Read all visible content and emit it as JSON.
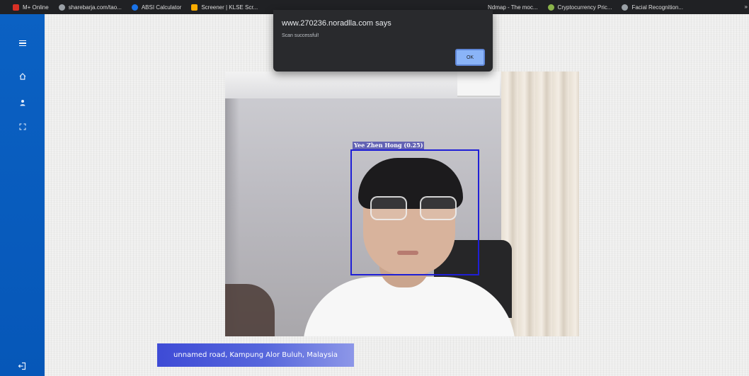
{
  "bookmarks_bar": {
    "left_items": [
      {
        "label": "M+ Online",
        "icon": "m-plus-icon",
        "color": "#d93025"
      },
      {
        "label": "sharebarja.com/tao...",
        "icon": "globe-icon",
        "color": "#9aa0a6"
      },
      {
        "label": "ABSI Calculator",
        "icon": "calculator-icon",
        "color": "#1a73e8"
      },
      {
        "label": "Screener | KLSE Scr...",
        "icon": "screener-icon",
        "color": "#f9ab00"
      }
    ],
    "right_items": [
      {
        "label": "Ndmap - The moc...",
        "icon": "bookmark-icon",
        "color": "#9aa0a6"
      },
      {
        "label": "Cryptocurrency Pric...",
        "icon": "crypto-icon",
        "color": "#8ab34a"
      },
      {
        "label": "Facial Recognition...",
        "icon": "globe-icon",
        "color": "#9aa0a6"
      }
    ],
    "overflow_text": "»"
  },
  "sidebar": {
    "accent": "#0b61c3",
    "items": [
      {
        "name": "menu",
        "icon": "hamburger-menu-icon"
      },
      {
        "name": "home",
        "icon": "home-icon"
      },
      {
        "name": "profile",
        "icon": "user-icon"
      },
      {
        "name": "scan",
        "icon": "scan-icon"
      },
      {
        "name": "logout",
        "icon": "logout-icon"
      }
    ]
  },
  "camera": {
    "detection_label": "Yee Zhen Hong (0.25)",
    "detection_color": "#1f1fd6"
  },
  "location": {
    "text": "unnamed road, Kampung Alor Buluh, Malaysia"
  },
  "dialog": {
    "title": "www.270236.noradlla.com says",
    "message": "Scan successful!",
    "ok_label": "OK"
  }
}
